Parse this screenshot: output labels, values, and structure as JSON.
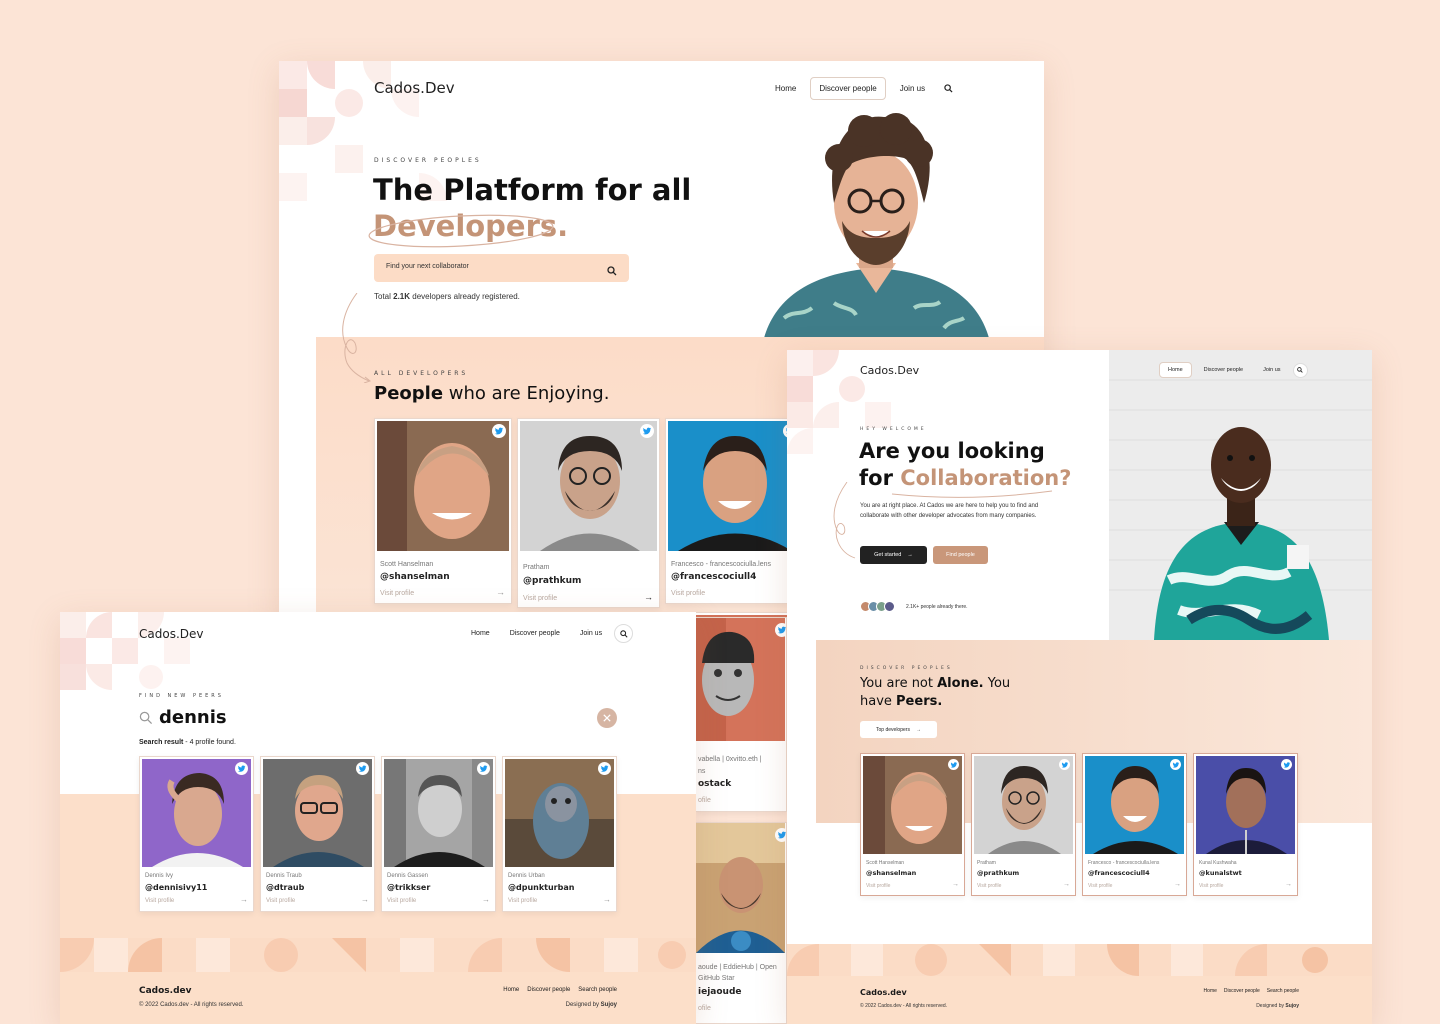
{
  "colors": {
    "page_bg": "#fce4d6",
    "accent": "#c49477",
    "twitter": "#1d9bf0",
    "dark": "#222222"
  },
  "screen1": {
    "brand": "Cados.Dev",
    "nav": [
      "Home",
      "Discover people",
      "Join us"
    ],
    "nav_active": "Discover people",
    "eyebrow": "DISCOVER PEOPLES",
    "title_line1": "The Platform for all",
    "title_line2": "Developers.",
    "search_placeholder": "Find your next collaborator",
    "total_prefix": "Total ",
    "total_count": "2.1K",
    "total_suffix": " developers already registered.",
    "section_eyebrow": "ALL DEVELOPERS",
    "section_title_bold": "People",
    "section_title_rest": " who are Enjoying.",
    "cards": [
      {
        "name": "Scott Hanselman",
        "handle": "@shanselman",
        "visit": "Visit profile"
      },
      {
        "name": "Pratham",
        "handle": "@prathkum",
        "visit": "Visit profile"
      },
      {
        "name": "Francesco - francescociulla.lens",
        "handle": "@francescociull4",
        "visit": "Visit profile"
      },
      {
        "name": "vabella | 0xvitto.eth |",
        "name2": "ns",
        "handle": "ostack",
        "visit": "ofile"
      },
      {
        "name": "aoude | EddieHub | Open",
        "name2": "GitHub Star",
        "handle": "iejaoude",
        "visit": "ofile"
      }
    ]
  },
  "screen2": {
    "brand": "Cados.Dev",
    "nav": [
      "Home",
      "Discover people",
      "Join us"
    ],
    "eyebrow": "FIND NEW PEERS",
    "query": "dennis",
    "result_label": "Search result",
    "result_count": " - 4 profile found.",
    "cards": [
      {
        "name": "Dennis Ivy",
        "handle": "@dennisivy11",
        "visit": "Visit profile"
      },
      {
        "name": "Dennis Traub",
        "handle": "@dtraub",
        "visit": "Visit profile"
      },
      {
        "name": "Dennis Gassen",
        "handle": "@trikkser",
        "visit": "Visit profile"
      },
      {
        "name": "Dennis Urban",
        "handle": "@dpunkturban",
        "visit": "Visit profile"
      }
    ],
    "footer_brand": "Cados.dev",
    "footer_copy": "© 2022 Cados.dev - All rights reserved.",
    "footer_links": [
      "Home",
      "Discover people",
      "Search people"
    ],
    "designed_by": "Designed by ",
    "designer": "Sujoy"
  },
  "screen3": {
    "brand": "Cados.Dev",
    "nav": [
      "Home",
      "Discover people",
      "Join us"
    ],
    "nav_active": "Home",
    "eyebrow": "HEY WELCOME",
    "title_line1": "Are you looking",
    "title_line2_prefix": "for ",
    "title_line2_accent": "Collaboration?",
    "description": "You are at right place. At Cados we are here to help you to find and collaborate with other developer advocates from many companies.",
    "cta_primary": "Get started",
    "cta_secondary": "Find people",
    "people_count": "2.1K+ people already there.",
    "section_eyebrow": "DISCOVER PEOPLES",
    "section_l1_a": "You are not ",
    "section_l1_b": "Alone.",
    "section_l1_c": " You",
    "section_l2_a": "have ",
    "section_l2_b": "Peers.",
    "top_btn": "Top developers",
    "cards": [
      {
        "name": "Scott Hanselman",
        "handle": "@shanselman",
        "visit": "Visit profile"
      },
      {
        "name": "Pratham",
        "handle": "@prathkum",
        "visit": "Visit profile"
      },
      {
        "name": "Francesco - francescociulla.lens",
        "handle": "@francescociull4",
        "visit": "Visit profile"
      },
      {
        "name": "Kunal Kushwaha",
        "handle": "@kunalstwt",
        "visit": "Visit profile"
      }
    ],
    "footer_brand": "Cados.dev",
    "footer_copy": "© 2022 Cados.dev - All rights reserved.",
    "footer_links": [
      "Home",
      "Discover people",
      "Search people"
    ],
    "designed_by": "Designed by ",
    "designer": "Sujoy"
  }
}
